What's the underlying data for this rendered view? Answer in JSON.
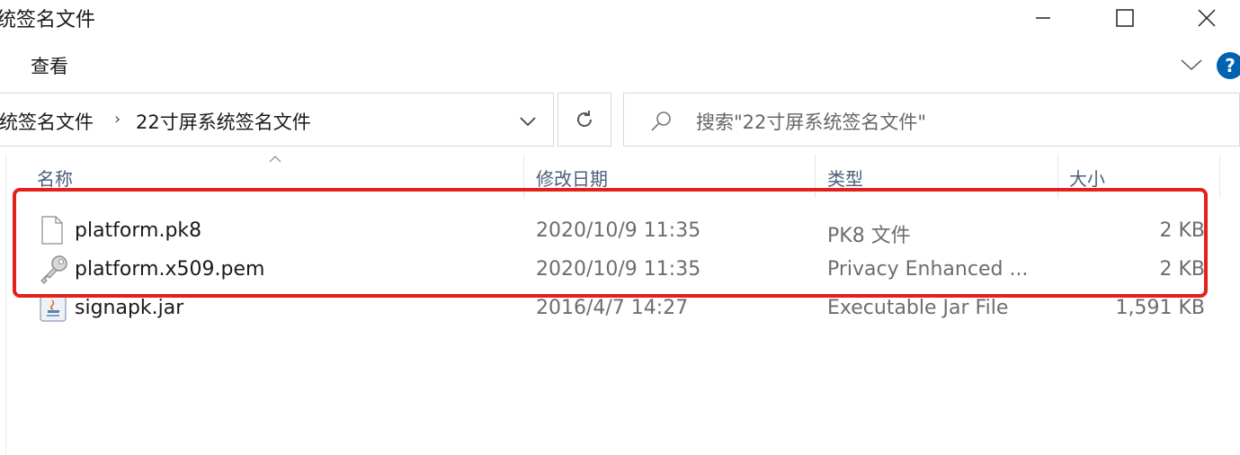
{
  "window": {
    "title": "统签名文件"
  },
  "ribbon": {
    "tab_view": "查看",
    "help_label": "?"
  },
  "address": {
    "crumb_parent": "统签名文件",
    "separator": "›",
    "crumb_current": "22寸屏系统签名文件"
  },
  "search": {
    "text": "搜索\"22寸屏系统签名文件\""
  },
  "columns": {
    "name": "名称",
    "modified": "修改日期",
    "type": "类型",
    "size": "大小"
  },
  "files": [
    {
      "name": "platform.pk8",
      "modified": "2020/10/9 11:35",
      "type": "PK8 文件",
      "size": "2 KB",
      "icon": "blank-file-icon"
    },
    {
      "name": "platform.x509.pem",
      "modified": "2020/10/9 11:35",
      "type": "Privacy Enhanced ...",
      "size": "2 KB",
      "icon": "certificate-key-icon"
    },
    {
      "name": "signapk.jar",
      "modified": "2016/4/7 14:27",
      "type": "Executable Jar File",
      "size": "1,591 KB",
      "icon": "java-jar-icon"
    }
  ],
  "colors": {
    "highlight": "#e3201b",
    "header_text": "#4c607a",
    "help_blue": "#0063b1"
  }
}
